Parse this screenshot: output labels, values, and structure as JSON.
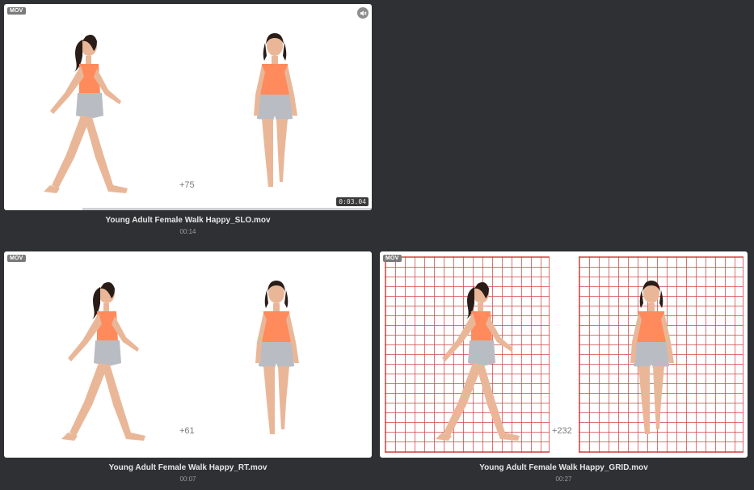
{
  "videos": [
    {
      "badge": "MOV",
      "counter": "+75",
      "timecode": "0:03.04",
      "title": "Young Adult Female Walk Happy_SLO.mov",
      "duration": "00:14",
      "muted_icon": "speaker-muted-icon"
    },
    {
      "badge": "MOV",
      "counter": "+61",
      "title": "Young Adult Female Walk Happy_RT.mov",
      "duration": "00:07"
    },
    {
      "badge": "MOV",
      "counter": "+232",
      "title": "Young Adult Female Walk Happy_GRID.mov",
      "duration": "00:27"
    }
  ],
  "colors": {
    "background": "#2f3033",
    "tank_top": "#ff8a5c",
    "shorts": "#b9bcc2",
    "skin": "#e9b798",
    "hair": "#2a1d18",
    "grid_line": "#d24646"
  }
}
